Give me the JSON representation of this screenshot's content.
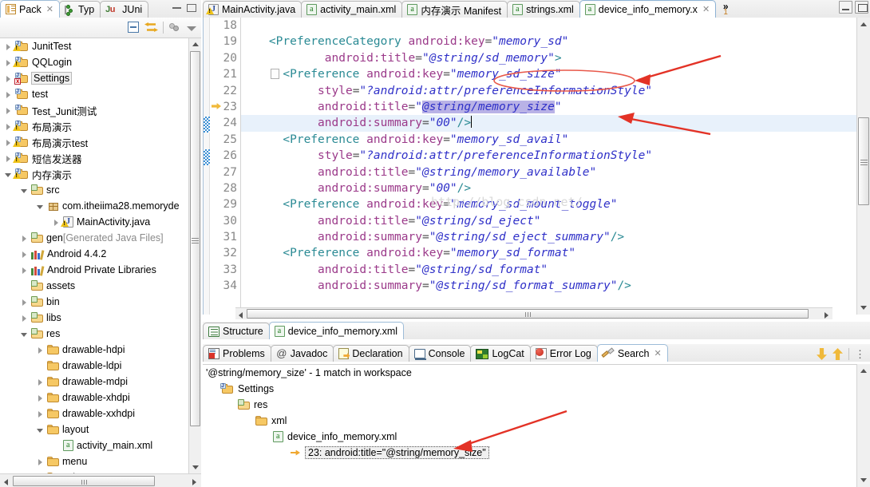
{
  "package_explorer": {
    "tabs": [
      {
        "label": "Pack",
        "icon": "package-explorer-icon",
        "closable": true,
        "active": true
      },
      {
        "label": "Typ",
        "icon": "type-hierarchy-icon",
        "closable": false,
        "active": false
      },
      {
        "label": "JUni",
        "icon": "junit-icon",
        "closable": false,
        "active": false
      }
    ],
    "view_buttons": [
      "minimize-view-button",
      "maximize-view-button"
    ],
    "toolbar_buttons": [
      "collapse-all-button",
      "link-with-editor-button",
      "view-menu-button",
      "view-dropdown-button"
    ],
    "tree": [
      {
        "label": "JunitTest",
        "icon": "java-project-icon",
        "indent": 0,
        "twisty": "closed",
        "warn": true
      },
      {
        "label": "QQLogin",
        "icon": "java-project-icon",
        "indent": 0,
        "twisty": "closed",
        "warn": true
      },
      {
        "label": "Settings",
        "icon": "java-project-icon",
        "indent": 0,
        "twisty": "closed",
        "warn": false,
        "error": true,
        "selected": true
      },
      {
        "label": "test",
        "icon": "java-project-icon",
        "indent": 0,
        "twisty": "closed",
        "warn": false
      },
      {
        "label": "Test_Junit测试",
        "icon": "java-project-icon",
        "indent": 0,
        "twisty": "closed",
        "warn": false
      },
      {
        "label": "布局演示",
        "icon": "java-project-icon",
        "indent": 0,
        "twisty": "closed",
        "warn": true
      },
      {
        "label": "布局演示test",
        "icon": "java-project-icon",
        "indent": 0,
        "twisty": "closed",
        "warn": true
      },
      {
        "label": "短信发送器",
        "icon": "java-project-icon",
        "indent": 0,
        "twisty": "closed",
        "warn": true
      },
      {
        "label": "内存演示",
        "icon": "java-project-icon",
        "indent": 0,
        "twisty": "open",
        "warn": true
      },
      {
        "label": "src",
        "icon": "source-folder-icon",
        "indent": 1,
        "twisty": "open"
      },
      {
        "label": "com.itheiima28.memoryde",
        "icon": "package-icon",
        "indent": 2,
        "twisty": "open"
      },
      {
        "label": "MainActivity.java",
        "icon": "java-file-icon",
        "indent": 3,
        "twisty": "closed",
        "warn": true
      },
      {
        "label": "gen",
        "suffix": " [Generated Java Files]",
        "icon": "source-folder-icon",
        "indent": 1,
        "twisty": "closed"
      },
      {
        "label": "Android 4.4.2",
        "icon": "library-icon",
        "indent": 1,
        "twisty": "closed"
      },
      {
        "label": "Android Private Libraries",
        "icon": "library-icon",
        "indent": 1,
        "twisty": "closed"
      },
      {
        "label": "assets",
        "icon": "source-folder-icon",
        "indent": 1,
        "twisty": "none"
      },
      {
        "label": "bin",
        "icon": "source-folder-icon",
        "indent": 1,
        "twisty": "closed"
      },
      {
        "label": "libs",
        "icon": "source-folder-icon",
        "indent": 1,
        "twisty": "closed"
      },
      {
        "label": "res",
        "icon": "source-folder-icon",
        "indent": 1,
        "twisty": "open"
      },
      {
        "label": "drawable-hdpi",
        "icon": "folder-icon",
        "indent": 2,
        "twisty": "closed"
      },
      {
        "label": "drawable-ldpi",
        "icon": "folder-icon",
        "indent": 2,
        "twisty": "none"
      },
      {
        "label": "drawable-mdpi",
        "icon": "folder-icon",
        "indent": 2,
        "twisty": "closed"
      },
      {
        "label": "drawable-xhdpi",
        "icon": "folder-icon",
        "indent": 2,
        "twisty": "closed"
      },
      {
        "label": "drawable-xxhdpi",
        "icon": "folder-icon",
        "indent": 2,
        "twisty": "closed"
      },
      {
        "label": "layout",
        "icon": "folder-icon",
        "indent": 2,
        "twisty": "open"
      },
      {
        "label": "activity_main.xml",
        "icon": "xml-file-icon",
        "indent": 3,
        "twisty": "none"
      },
      {
        "label": "menu",
        "icon": "folder-icon",
        "indent": 2,
        "twisty": "closed"
      },
      {
        "label": "values",
        "icon": "folder-icon",
        "indent": 2,
        "twisty": "closed"
      }
    ]
  },
  "editor": {
    "tabs": [
      {
        "label": "MainActivity.java",
        "icon": "java-file-icon",
        "warn": true,
        "active": false,
        "closable": false
      },
      {
        "label": "activity_main.xml",
        "icon": "xml-file-icon",
        "active": false,
        "closable": false
      },
      {
        "label": "内存演示 Manifest",
        "icon": "xml-file-icon",
        "active": false,
        "closable": false
      },
      {
        "label": "strings.xml",
        "icon": "xml-file-icon",
        "active": false,
        "closable": false
      },
      {
        "label": "device_info_memory.x",
        "icon": "xml-file-icon",
        "active": true,
        "closable": true
      }
    ],
    "overflow_count": "1",
    "overflow_symbol": "»",
    "window_controls": [
      "restore-editor-button",
      "maximize-editor-button"
    ],
    "first_line_number": 18,
    "highlighted_line": 24,
    "marker_line": 23,
    "watermark": "http://blog.csdn.net/",
    "lines": [
      {
        "n": 18,
        "tokens": []
      },
      {
        "n": 19,
        "tokens": [
          {
            "t": "punc",
            "v": "    <"
          },
          {
            "t": "tag",
            "v": "PreferenceCategory"
          },
          {
            "t": "plain",
            "v": " "
          },
          {
            "t": "attr",
            "v": "android:key"
          },
          {
            "t": "eqs",
            "v": "="
          },
          {
            "t": "strq",
            "v": "\""
          },
          {
            "t": "str",
            "v": "memory_sd"
          },
          {
            "t": "strq",
            "v": "\""
          }
        ]
      },
      {
        "n": 20,
        "tokens": [
          {
            "t": "plain",
            "v": "            "
          },
          {
            "t": "attr",
            "v": "android:title"
          },
          {
            "t": "eqs",
            "v": "="
          },
          {
            "t": "strq",
            "v": "\""
          },
          {
            "t": "str",
            "v": "@string/sd_memory"
          },
          {
            "t": "strq",
            "v": "\""
          },
          {
            "t": "punc",
            "v": ">"
          }
        ]
      },
      {
        "n": 21,
        "fold": true,
        "tokens": [
          {
            "t": "punc",
            "v": "      <"
          },
          {
            "t": "tag",
            "v": "Preference"
          },
          {
            "t": "plain",
            "v": " "
          },
          {
            "t": "attr",
            "v": "android:key"
          },
          {
            "t": "eqs",
            "v": "="
          },
          {
            "t": "strq",
            "v": "\""
          },
          {
            "t": "str",
            "v": "memory_sd_size"
          },
          {
            "t": "strq",
            "v": "\""
          }
        ]
      },
      {
        "n": 22,
        "tokens": [
          {
            "t": "plain",
            "v": "           "
          },
          {
            "t": "attr",
            "v": "style"
          },
          {
            "t": "eqs",
            "v": "="
          },
          {
            "t": "strq",
            "v": "\""
          },
          {
            "t": "str",
            "v": "?android:attr/preferenceInformationStyle"
          },
          {
            "t": "strq",
            "v": "\""
          }
        ]
      },
      {
        "n": 23,
        "tokens": [
          {
            "t": "plain",
            "v": "           "
          },
          {
            "t": "attr",
            "v": "android:title"
          },
          {
            "t": "eqs",
            "v": "="
          },
          {
            "t": "strq",
            "v": "\""
          },
          {
            "t": "sel",
            "v": "@string/memory_size"
          },
          {
            "t": "strq",
            "v": "\""
          }
        ]
      },
      {
        "n": 24,
        "highlight": true,
        "caret": true,
        "tokens": [
          {
            "t": "plain",
            "v": "           "
          },
          {
            "t": "attr",
            "v": "android:summary"
          },
          {
            "t": "eqs",
            "v": "="
          },
          {
            "t": "strq",
            "v": "\""
          },
          {
            "t": "str",
            "v": "00"
          },
          {
            "t": "strq",
            "v": "\""
          },
          {
            "t": "punc",
            "v": "/>"
          }
        ]
      },
      {
        "n": 25,
        "tokens": [
          {
            "t": "punc",
            "v": "      <"
          },
          {
            "t": "tag",
            "v": "Preference"
          },
          {
            "t": "plain",
            "v": " "
          },
          {
            "t": "attr",
            "v": "android:key"
          },
          {
            "t": "eqs",
            "v": "="
          },
          {
            "t": "strq",
            "v": "\""
          },
          {
            "t": "str",
            "v": "memory_sd_avail"
          },
          {
            "t": "strq",
            "v": "\""
          }
        ]
      },
      {
        "n": 26,
        "tokens": [
          {
            "t": "plain",
            "v": "           "
          },
          {
            "t": "attr",
            "v": "style"
          },
          {
            "t": "eqs",
            "v": "="
          },
          {
            "t": "strq",
            "v": "\""
          },
          {
            "t": "str",
            "v": "?android:attr/preferenceInformationStyle"
          },
          {
            "t": "strq",
            "v": "\""
          }
        ]
      },
      {
        "n": 27,
        "tokens": [
          {
            "t": "plain",
            "v": "           "
          },
          {
            "t": "attr",
            "v": "android:title"
          },
          {
            "t": "eqs",
            "v": "="
          },
          {
            "t": "strq",
            "v": "\""
          },
          {
            "t": "str",
            "v": "@string/memory_available"
          },
          {
            "t": "strq",
            "v": "\""
          }
        ]
      },
      {
        "n": 28,
        "tokens": [
          {
            "t": "plain",
            "v": "           "
          },
          {
            "t": "attr",
            "v": "android:summary"
          },
          {
            "t": "eqs",
            "v": "="
          },
          {
            "t": "strq",
            "v": "\""
          },
          {
            "t": "str",
            "v": "00"
          },
          {
            "t": "strq",
            "v": "\""
          },
          {
            "t": "punc",
            "v": "/>"
          }
        ]
      },
      {
        "n": 29,
        "tokens": [
          {
            "t": "punc",
            "v": "      <"
          },
          {
            "t": "tag",
            "v": "Preference"
          },
          {
            "t": "plain",
            "v": " "
          },
          {
            "t": "attr",
            "v": "android:key"
          },
          {
            "t": "eqs",
            "v": "="
          },
          {
            "t": "strq",
            "v": "\""
          },
          {
            "t": "str",
            "v": "memory_sd_mount_toggle"
          },
          {
            "t": "strq",
            "v": "\""
          }
        ]
      },
      {
        "n": 30,
        "tokens": [
          {
            "t": "plain",
            "v": "           "
          },
          {
            "t": "attr",
            "v": "android:title"
          },
          {
            "t": "eqs",
            "v": "="
          },
          {
            "t": "strq",
            "v": "\""
          },
          {
            "t": "str",
            "v": "@string/sd_eject"
          },
          {
            "t": "strq",
            "v": "\""
          }
        ]
      },
      {
        "n": 31,
        "tokens": [
          {
            "t": "plain",
            "v": "           "
          },
          {
            "t": "attr",
            "v": "android:summary"
          },
          {
            "t": "eqs",
            "v": "="
          },
          {
            "t": "strq",
            "v": "\""
          },
          {
            "t": "str",
            "v": "@string/sd_eject_summary"
          },
          {
            "t": "strq",
            "v": "\""
          },
          {
            "t": "punc",
            "v": "/>"
          }
        ]
      },
      {
        "n": 32,
        "tokens": [
          {
            "t": "punc",
            "v": "      <"
          },
          {
            "t": "tag",
            "v": "Preference"
          },
          {
            "t": "plain",
            "v": " "
          },
          {
            "t": "attr",
            "v": "android:key"
          },
          {
            "t": "eqs",
            "v": "="
          },
          {
            "t": "strq",
            "v": "\""
          },
          {
            "t": "str",
            "v": "memory_sd_format"
          },
          {
            "t": "strq",
            "v": "\""
          }
        ]
      },
      {
        "n": 33,
        "tokens": [
          {
            "t": "plain",
            "v": "           "
          },
          {
            "t": "attr",
            "v": "android:title"
          },
          {
            "t": "eqs",
            "v": "="
          },
          {
            "t": "strq",
            "v": "\""
          },
          {
            "t": "str",
            "v": "@string/sd_format"
          },
          {
            "t": "strq",
            "v": "\""
          }
        ]
      },
      {
        "n": 34,
        "clipped": true,
        "tokens": [
          {
            "t": "plain",
            "v": "           "
          },
          {
            "t": "attr",
            "v": "android:summary"
          },
          {
            "t": "eqs",
            "v": "="
          },
          {
            "t": "strq",
            "v": "\""
          },
          {
            "t": "str",
            "v": "@string/sd_format_summary"
          },
          {
            "t": "strq",
            "v": "\""
          },
          {
            "t": "punc",
            "v": "/>"
          }
        ]
      }
    ]
  },
  "structure_bar": {
    "tabs": [
      {
        "label": "Structure",
        "icon": "structure-icon",
        "active": false
      },
      {
        "label": "device_info_memory.xml",
        "icon": "xml-source-icon",
        "active": true
      }
    ]
  },
  "bottom_view": {
    "tabs": [
      {
        "label": "Problems",
        "icon": "problems-icon",
        "active": false
      },
      {
        "label": "Javadoc",
        "icon": "javadoc-icon",
        "active": false
      },
      {
        "label": "Declaration",
        "icon": "declaration-icon",
        "active": false
      },
      {
        "label": "Console",
        "icon": "console-icon",
        "active": false
      },
      {
        "label": "LogCat",
        "icon": "logcat-icon",
        "active": false
      },
      {
        "label": "Error Log",
        "icon": "error-log-icon",
        "active": false
      },
      {
        "label": "Search",
        "icon": "search-icon",
        "active": true,
        "closable": true
      }
    ],
    "toolbar": [
      "next-match-button",
      "previous-match-button",
      "view-menu-button"
    ],
    "result_header": "'@string/memory_size' - 1 match in workspace",
    "results": [
      {
        "label": "Settings",
        "icon": "java-project-icon",
        "indent": 0
      },
      {
        "label": "res",
        "icon": "source-folder-icon",
        "indent": 1
      },
      {
        "label": "xml",
        "icon": "folder-icon",
        "indent": 2
      },
      {
        "label": "device_info_memory.xml",
        "icon": "xml-file-icon",
        "indent": 3
      },
      {
        "label": "23: android:title=\"@string/memory_size\"",
        "icon": "match-icon",
        "indent": 4,
        "boxed": true
      }
    ]
  },
  "annotations": {
    "color": "#e33226",
    "items": [
      {
        "name": "ellipse-memory-sd-size",
        "shape": "ellipse"
      },
      {
        "name": "arrow-to-memory-sd-size",
        "shape": "arrow"
      },
      {
        "name": "arrow-to-memory-size-title",
        "shape": "arrow"
      },
      {
        "name": "arrow-to-search-match",
        "shape": "arrow"
      }
    ]
  }
}
